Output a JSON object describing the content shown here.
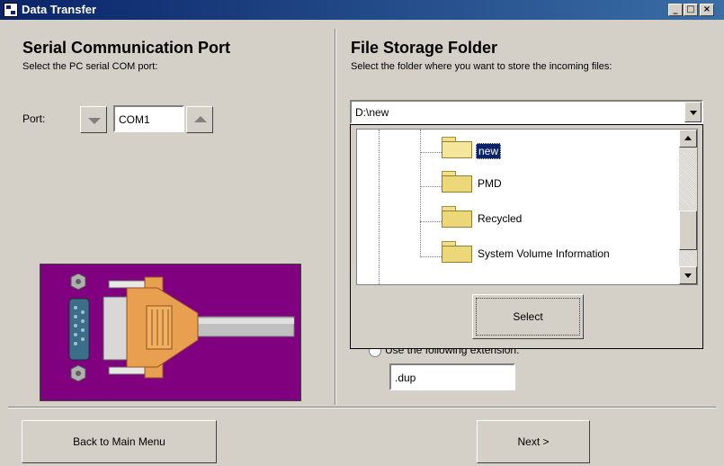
{
  "window": {
    "title": "Data Transfer"
  },
  "left": {
    "title": "Serial Communication Port",
    "subtitle": "Select the PC serial COM port:",
    "port_label": "Port:",
    "port_value": "COM1"
  },
  "right": {
    "title": "File Storage Folder",
    "subtitle": "Select the folder where you want to store the incoming files:",
    "path_value": "D:\\new",
    "tree": [
      {
        "label": "new",
        "selected": true
      },
      {
        "label": "PMD",
        "selected": false
      },
      {
        "label": "Recycled",
        "selected": false
      },
      {
        "label": "System Volume Information",
        "selected": false
      }
    ],
    "select_button": "Select",
    "extension_label": "Use the following extension:",
    "extension_value": ".dup"
  },
  "footer": {
    "back_button": "Back to Main Menu",
    "next_button": "Next >"
  },
  "colors": {
    "titlebar_start": "#0a246a",
    "titlebar_end": "#3a6ea5",
    "selection": "#0a246a",
    "illustration_bg": "#800080"
  }
}
